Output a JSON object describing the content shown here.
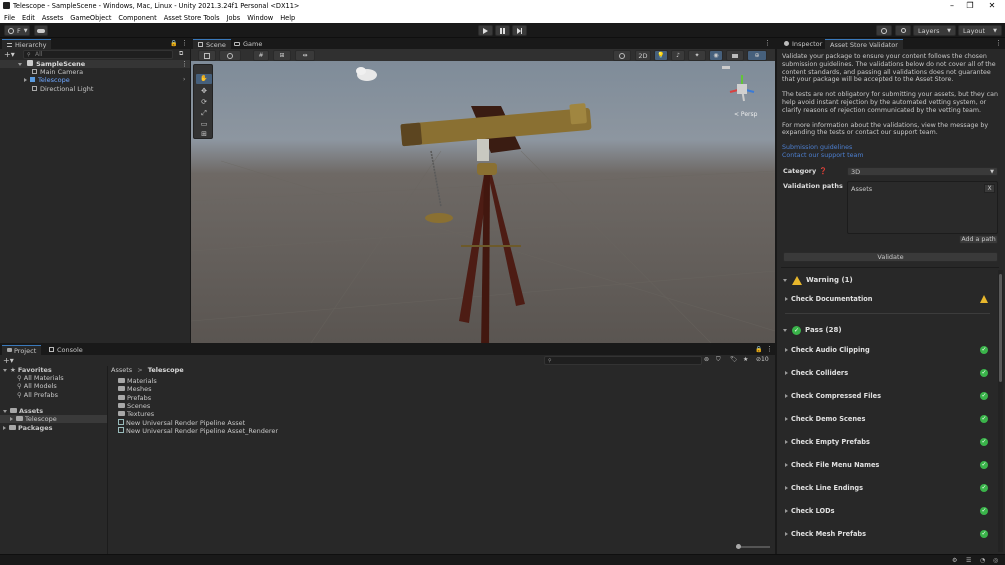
{
  "window": {
    "title": "Telescope - SampleScene - Windows, Mac, Linux - Unity 2021.3.24f1 Personal <DX11>",
    "controls": [
      "–",
      "❐",
      "✕"
    ]
  },
  "menu": [
    "File",
    "Edit",
    "Assets",
    "GameObject",
    "Component",
    "Asset Store Tools",
    "Jobs",
    "Window",
    "Help"
  ],
  "toolbar": {
    "account": "F",
    "layers_label": "Layers",
    "layout_label": "Layout"
  },
  "hierarchy": {
    "tab": "Hierarchy",
    "search_placeholder": "All",
    "scene": "SampleScene",
    "items": [
      "Main Camera",
      "Telescope",
      "Directional Light"
    ]
  },
  "scene_view": {
    "tabs": [
      "Scene",
      "Game"
    ],
    "mode_2d": "2D",
    "persp_label": "< Persp"
  },
  "project": {
    "tabs": [
      "Project",
      "Console"
    ],
    "favorites_label": "Favorites",
    "favorites": [
      "All Materials",
      "All Models",
      "All Prefabs"
    ],
    "assets_label": "Assets",
    "asset_children": [
      "Telescope"
    ],
    "packages_label": "Packages",
    "breadcrumb_root": "Assets",
    "breadcrumb_current": "Telescope",
    "files": [
      "Materials",
      "Meshes",
      "Prefabs",
      "Scenes",
      "Textures",
      "New Universal Render Pipeline Asset",
      "New Universal Render Pipeline Asset_Renderer"
    ],
    "hidden_count": "10"
  },
  "inspector": {
    "tabs": [
      "Inspector",
      "Asset Store Validator"
    ],
    "intro1": "Validate your package to ensure your content follows the chosen submission guidelines. The validations below do not cover all of the content standards, and passing all validations does not guarantee that your package will be accepted to the Asset Store.",
    "intro2": "The tests are not obligatory for submitting your assets, but they can help avoid instant rejection by the automated vetting system, or clarify reasons of rejection communicated by the vetting team.",
    "intro3": "For more information about the validations, view the message by expanding the tests or contact our support team.",
    "link1": "Submission guidelines",
    "link2": "Contact our support team",
    "category_label": "Category",
    "category_value": "3D",
    "validation_paths_label": "Validation paths",
    "validation_path": "Assets",
    "remove_path": "X",
    "add_path": "Add a path",
    "validate_button": "Validate",
    "warning_header": "Warning (1)",
    "warning_items": [
      "Check Documentation"
    ],
    "pass_header": "Pass (28)",
    "pass_items": [
      "Check Audio Clipping",
      "Check Colliders",
      "Check Compressed Files",
      "Check Demo Scenes",
      "Check Empty Prefabs",
      "Check File Menu Names",
      "Check Line Endings",
      "Check LODs",
      "Check Mesh Prefabs"
    ]
  },
  "colors": {
    "accent": "#3a79bb",
    "link": "#4c7fd0",
    "pass": "#3ab34a",
    "warning": "#e8b72c",
    "panel": "#282828",
    "background": "#191919"
  }
}
